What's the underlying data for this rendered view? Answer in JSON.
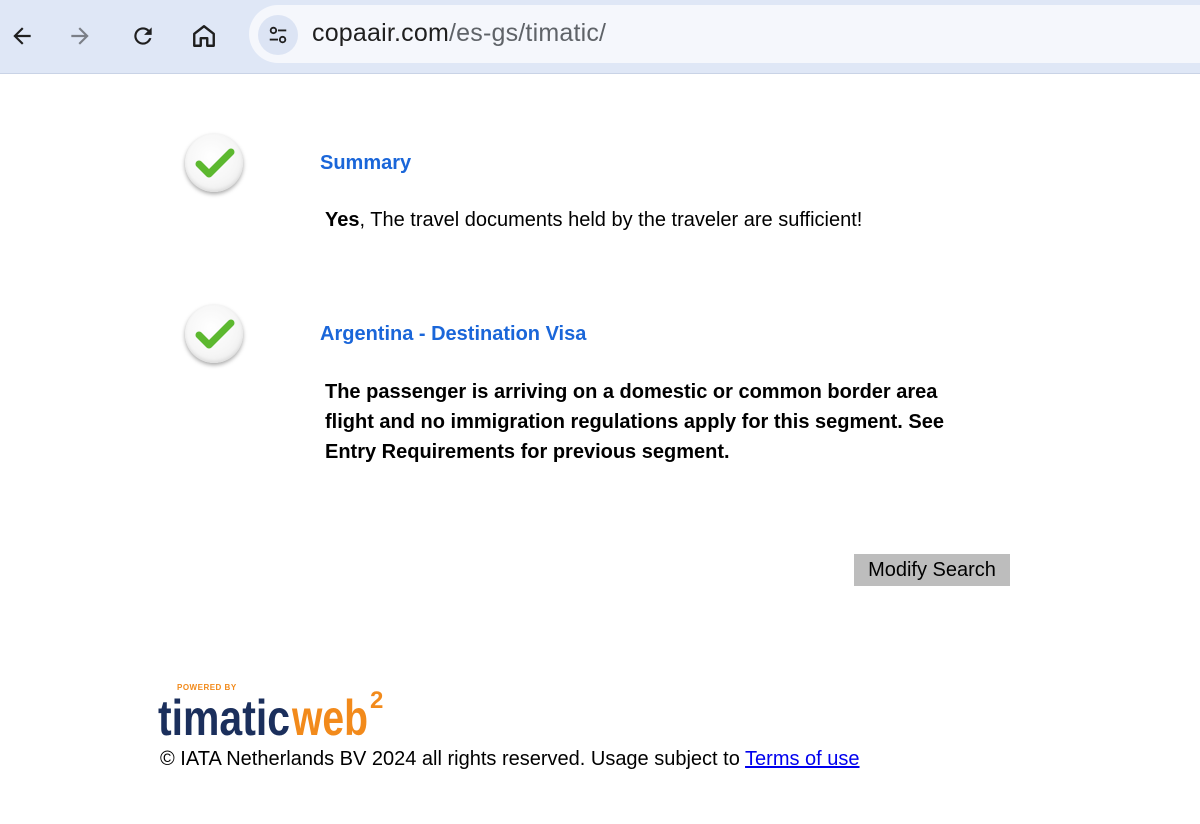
{
  "browser": {
    "url_domain": "copaair.com",
    "url_path": "/es-gs/timatic/"
  },
  "results": [
    {
      "title": "Summary",
      "text_bold": "Yes",
      "text_rest": ", The travel documents held by the traveler are sufficient!"
    },
    {
      "title": "Argentina - Destination Visa",
      "text": "The passenger is arriving on a domestic or common border area flight and no immigration regulations apply for this segment. See Entry Requirements for previous segment."
    }
  ],
  "actions": {
    "modify_search_label": "Modify Search"
  },
  "logo": {
    "powered_by": "POWERED BY",
    "word1": "timatic",
    "word2": "web",
    "superscript": "2"
  },
  "footer": {
    "copyright_text": "© IATA Netherlands BV 2024 all rights reserved. Usage subject to",
    "terms_link": "Terms of use"
  },
  "colors": {
    "title_blue": "#1a66d9",
    "check_green": "#5cb82f",
    "logo_navy": "#1b2f5c",
    "logo_orange": "#f28a1b"
  }
}
